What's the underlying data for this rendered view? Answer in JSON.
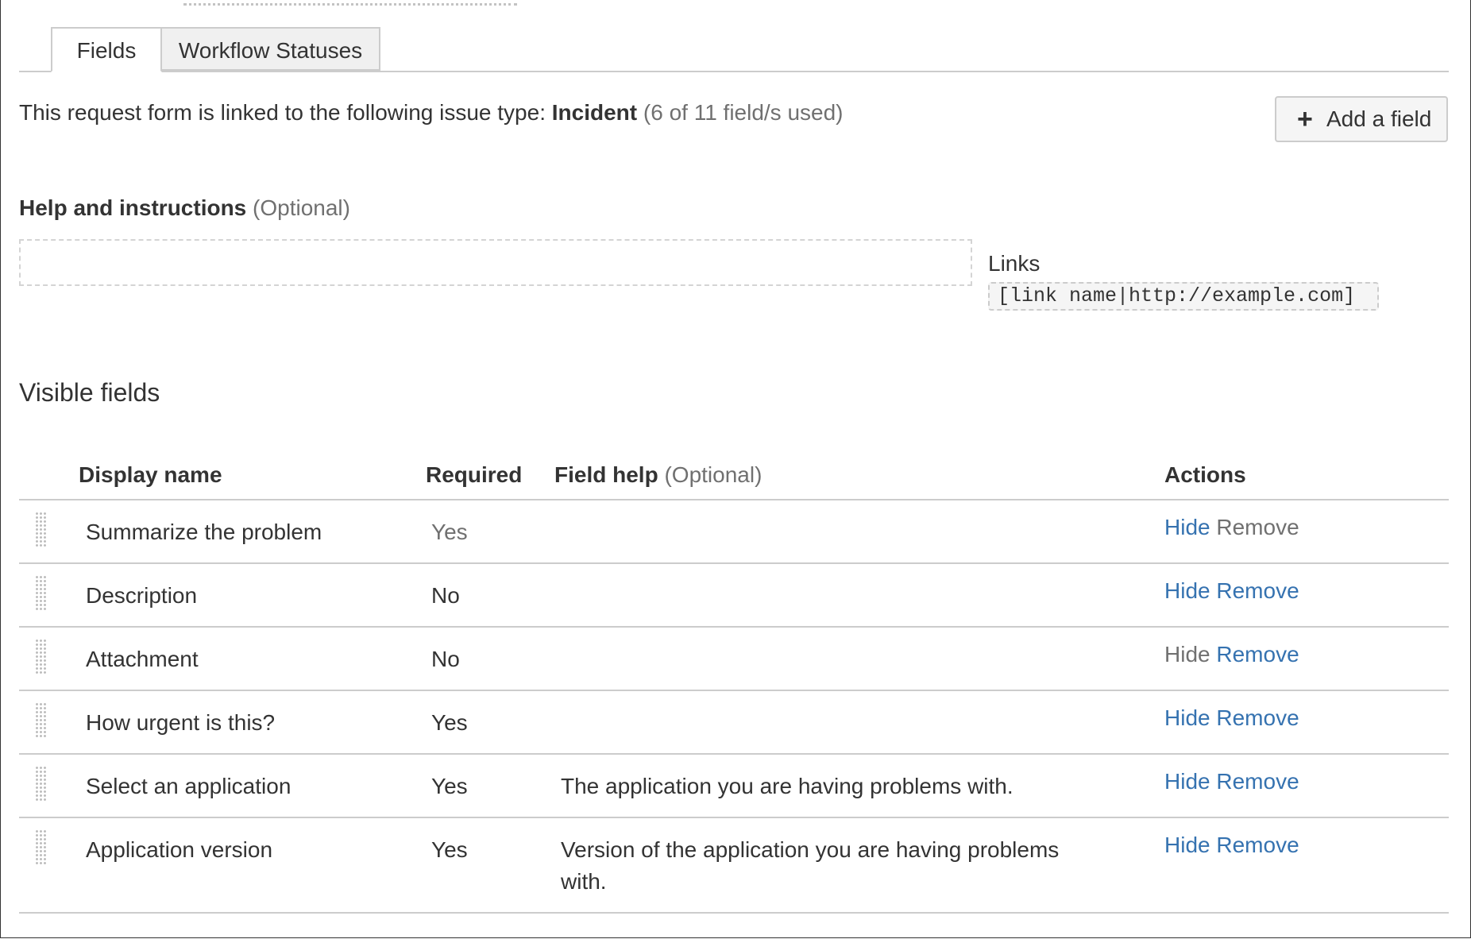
{
  "tabs": [
    {
      "label": "Fields",
      "active": true
    },
    {
      "label": "Workflow Statuses",
      "active": false
    }
  ],
  "intro": {
    "prefix": "This request form is linked to the following issue type: ",
    "issue_type": "Incident",
    "usage": " (6 of 11 field/s used)"
  },
  "add_field_button": {
    "icon": "plus-icon",
    "label": "Add a field"
  },
  "help": {
    "label": "Help and instructions",
    "optional": " (Optional)",
    "value": ""
  },
  "links": {
    "title": "Links",
    "syntax": "[link name|http://example.com]"
  },
  "visible_fields": {
    "title": "Visible fields",
    "columns": {
      "display_name": "Display name",
      "required": "Required",
      "field_help": "Field help",
      "field_help_optional": " (Optional)",
      "actions": "Actions"
    },
    "rows": [
      {
        "name": "Summarize the problem",
        "required": "Yes",
        "help": "",
        "hide": "Hide",
        "remove": "Remove",
        "hide_enabled": true,
        "remove_enabled": false,
        "required_dim": true
      },
      {
        "name": "Description",
        "required": "No",
        "help": "",
        "hide": "Hide",
        "remove": "Remove",
        "hide_enabled": true,
        "remove_enabled": true
      },
      {
        "name": "Attachment",
        "required": "No",
        "help": "",
        "hide": "Hide",
        "remove": "Remove",
        "hide_enabled": false,
        "remove_enabled": true
      },
      {
        "name": "How urgent is this?",
        "required": "Yes",
        "help": "",
        "hide": "Hide",
        "remove": "Remove",
        "hide_enabled": true,
        "remove_enabled": true
      },
      {
        "name": "Select an application",
        "required": "Yes",
        "help": "The application you are having problems with.",
        "hide": "Hide",
        "remove": "Remove",
        "hide_enabled": true,
        "remove_enabled": true
      },
      {
        "name": "Application version",
        "required": "Yes",
        "help": "Version of the application you are having problems with.",
        "hide": "Hide",
        "remove": "Remove",
        "hide_enabled": true,
        "remove_enabled": true
      }
    ]
  },
  "colors": {
    "link": "#3572b0",
    "muted": "#707070",
    "border": "#cccccc"
  }
}
